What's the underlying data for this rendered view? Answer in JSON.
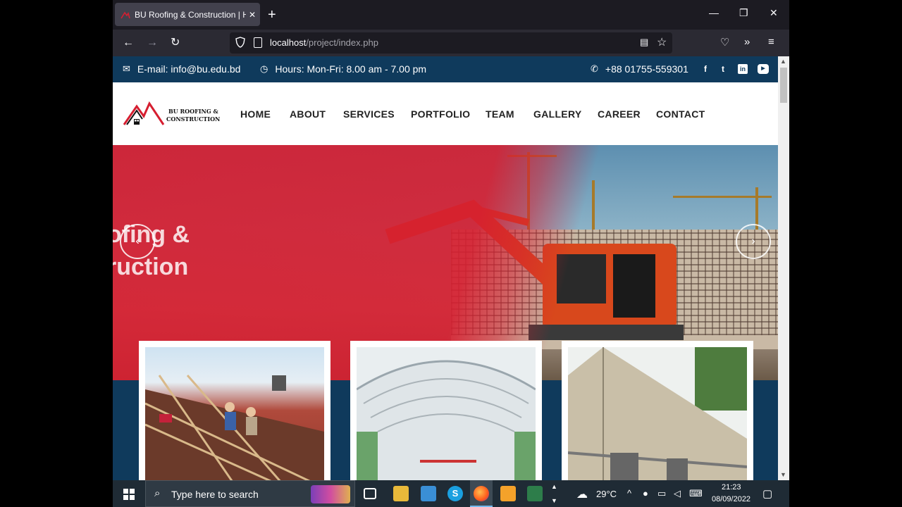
{
  "browser": {
    "tab_title": "BU Roofing & Construction | Home",
    "url_host": "localhost",
    "url_path": "/project/index.php"
  },
  "topbar": {
    "email": "E-mail: info@bu.edu.bd",
    "hours": "Hours: Mon-Fri: 8.00 am - 7.00 pm",
    "phone": "+88 01755-559301",
    "social": [
      "facebook-icon",
      "twitter-icon",
      "linkedin-icon",
      "youtube-icon"
    ]
  },
  "logo": {
    "line1": "BU ROOFING &",
    "line2": "CONSTRUCTION"
  },
  "nav": {
    "items": [
      "HOME",
      "ABOUT",
      "SERVICES",
      "PORTFOLIO",
      "TEAM",
      "GALLERY",
      "CAREER",
      "CONTACT"
    ]
  },
  "hero": {
    "line1": "ofing &",
    "line2": "ruction"
  },
  "colors": {
    "primary_red": "#d61e30",
    "navy": "#0f3a5c"
  },
  "taskbar": {
    "search_placeholder": "Type here to search",
    "weather": "29°C",
    "time": "21:23",
    "date": "08/09/2022"
  }
}
